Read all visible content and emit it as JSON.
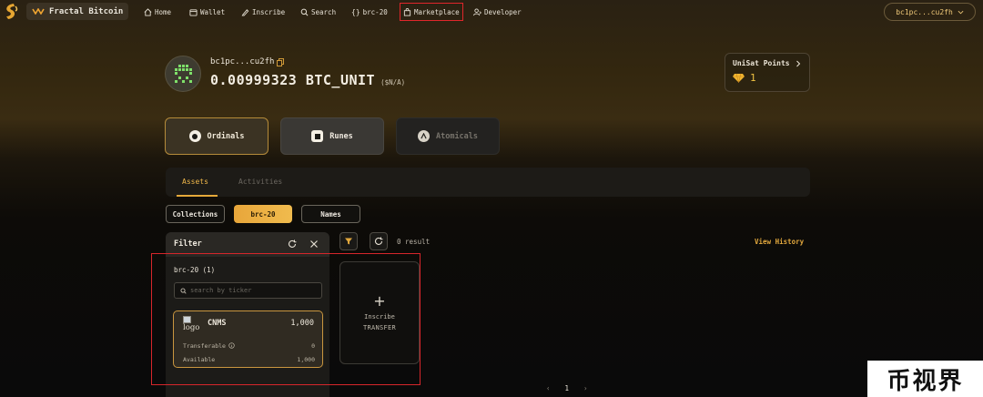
{
  "nav": {
    "brand": "Fractal Bitcoin",
    "items": [
      {
        "label": "Home",
        "icon": "home-icon"
      },
      {
        "label": "Wallet",
        "icon": "wallet-icon"
      },
      {
        "label": "Inscribe",
        "icon": "pen-icon"
      },
      {
        "label": "Search",
        "icon": "search-icon"
      },
      {
        "label": "brc-20",
        "icon": "braces-icon"
      },
      {
        "label": "Marketplace",
        "icon": "bag-icon",
        "highlighted": true
      },
      {
        "label": "Developer",
        "icon": "developer-icon"
      }
    ],
    "account_address": "bc1pc...cu2fh"
  },
  "account": {
    "address": "bc1pc...cu2fh",
    "balance": "0.00999323 BTC_UNIT",
    "balance_usd": "($N/A)"
  },
  "points": {
    "title": "UniSat Points",
    "value": "1"
  },
  "protocol_tabs": [
    {
      "label": "Ordinals",
      "active": true
    },
    {
      "label": "Runes",
      "active": false
    },
    {
      "label": "Atomicals",
      "active": false,
      "disabled": true
    }
  ],
  "sub_tabs": {
    "assets": "Assets",
    "activities": "Activities"
  },
  "asset_type_pills": {
    "collections": "Collections",
    "brc20": "brc-20",
    "names": "Names"
  },
  "filter": {
    "title": "Filter",
    "section": "brc-20 (1)",
    "search_placeholder": "search by ticker",
    "token": {
      "logo_alt": "logo",
      "ticker": "CNMS",
      "amount": "1,000",
      "transferable_label": "Transferable",
      "transferable_value": "0",
      "available_label": "Available",
      "available_value": "1,000"
    }
  },
  "results": {
    "count": "0 result",
    "view_history": "View History"
  },
  "inscribe_card": {
    "line1": "Inscribe",
    "line2": "TRANSFER"
  },
  "pager": {
    "current": "1"
  },
  "watermark": "币视界",
  "colors": {
    "accent": "#e8a63a",
    "highlight_red": "#d6262b",
    "token_border": "#c9963f"
  }
}
